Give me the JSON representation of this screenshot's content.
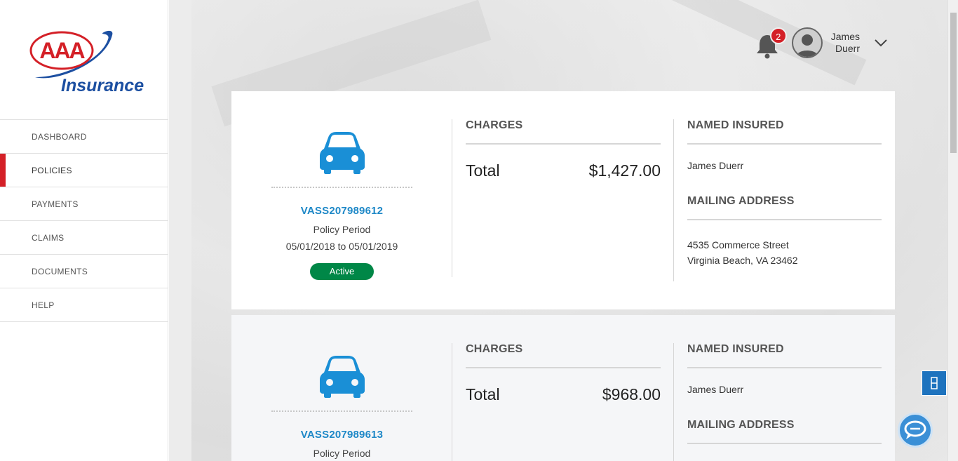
{
  "brand": {
    "logo_letters": "AAA",
    "logo_word": "Insurance",
    "brand_red": "#d42027",
    "brand_blue": "#1c4fa1"
  },
  "nav": {
    "items": [
      {
        "label": "DASHBOARD"
      },
      {
        "label": "POLICIES",
        "active": true
      },
      {
        "label": "PAYMENTS"
      },
      {
        "label": "CLAIMS"
      },
      {
        "label": "DOCUMENTS"
      },
      {
        "label": "HELP"
      }
    ]
  },
  "header": {
    "notification_count": "2",
    "user_first": "James",
    "user_last": "Duerr",
    "icons": [
      "bell-icon",
      "avatar-icon",
      "chevron-down-icon"
    ]
  },
  "policies": [
    {
      "icon": "car-icon",
      "policy_number": "VASS207989612",
      "period_label": "Policy Period",
      "period": "05/01/2018 to 05/01/2019",
      "status": "Active",
      "charges_title": "CHARGES",
      "total_label": "Total",
      "total_value": "$1,427.00",
      "named_insured_title": "NAMED INSURED",
      "named_insured": "James Duerr",
      "mailing_title": "MAILING ADDRESS",
      "address_line1": "4535 Commerce Street",
      "address_line2": "Virginia Beach, VA 23462"
    },
    {
      "icon": "car-icon",
      "policy_number": "VASS207989613",
      "period_label": "Policy Period",
      "charges_title": "CHARGES",
      "total_label": "Total",
      "total_value": "$968.00",
      "named_insured_title": "NAMED INSURED",
      "named_insured": "James Duerr",
      "mailing_title": "MAILING ADDRESS"
    }
  ],
  "colors": {
    "link_blue": "#1e88c7",
    "car_blue": "#1a8fd6",
    "active_green": "#008747"
  },
  "widgets": [
    "feedback-icon",
    "chat-icon"
  ]
}
